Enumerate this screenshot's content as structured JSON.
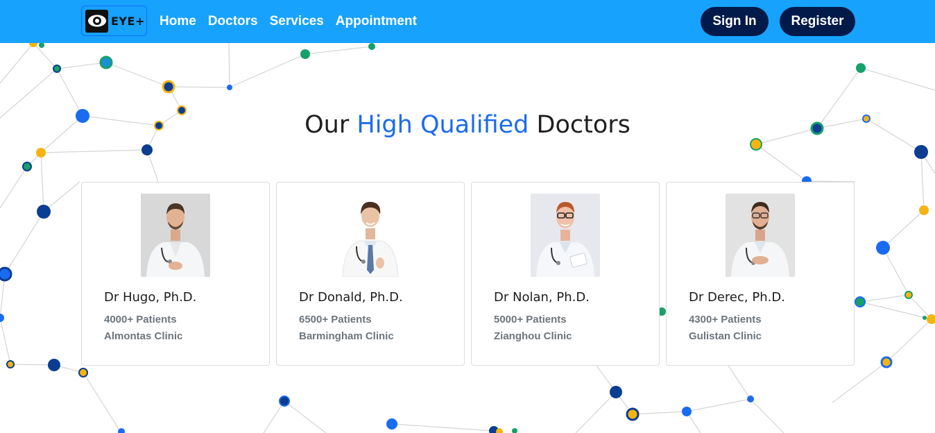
{
  "brand": {
    "logo_text": "EYE+"
  },
  "nav": {
    "links": [
      "Home",
      "Doctors",
      "Services",
      "Appointment"
    ],
    "sign_in": "Sign In",
    "register": "Register"
  },
  "heading": {
    "part1": "Our ",
    "highlight": "High Qualified",
    "part2": " Doctors"
  },
  "doctors": [
    {
      "name": "Dr Hugo, Ph.D.",
      "patients": "4000+ Patients",
      "clinic": "Almontas Clinic"
    },
    {
      "name": "Dr Donald, Ph.D.",
      "patients": "6500+ Patients",
      "clinic": "Barmingham Clinic"
    },
    {
      "name": "Dr Nolan, Ph.D.",
      "patients": "5000+ Patients",
      "clinic": "Zianghou Clinic"
    },
    {
      "name": "Dr Derec, Ph.D.",
      "patients": "4300+ Patients",
      "clinic": "Gulistan Clinic"
    }
  ],
  "colors": {
    "navbar": "#17a2fd",
    "button": "#021a4a",
    "accent": "#1a6bf0",
    "meta_text": "#6c757d"
  },
  "icons": {
    "logo": "eye-icon"
  }
}
